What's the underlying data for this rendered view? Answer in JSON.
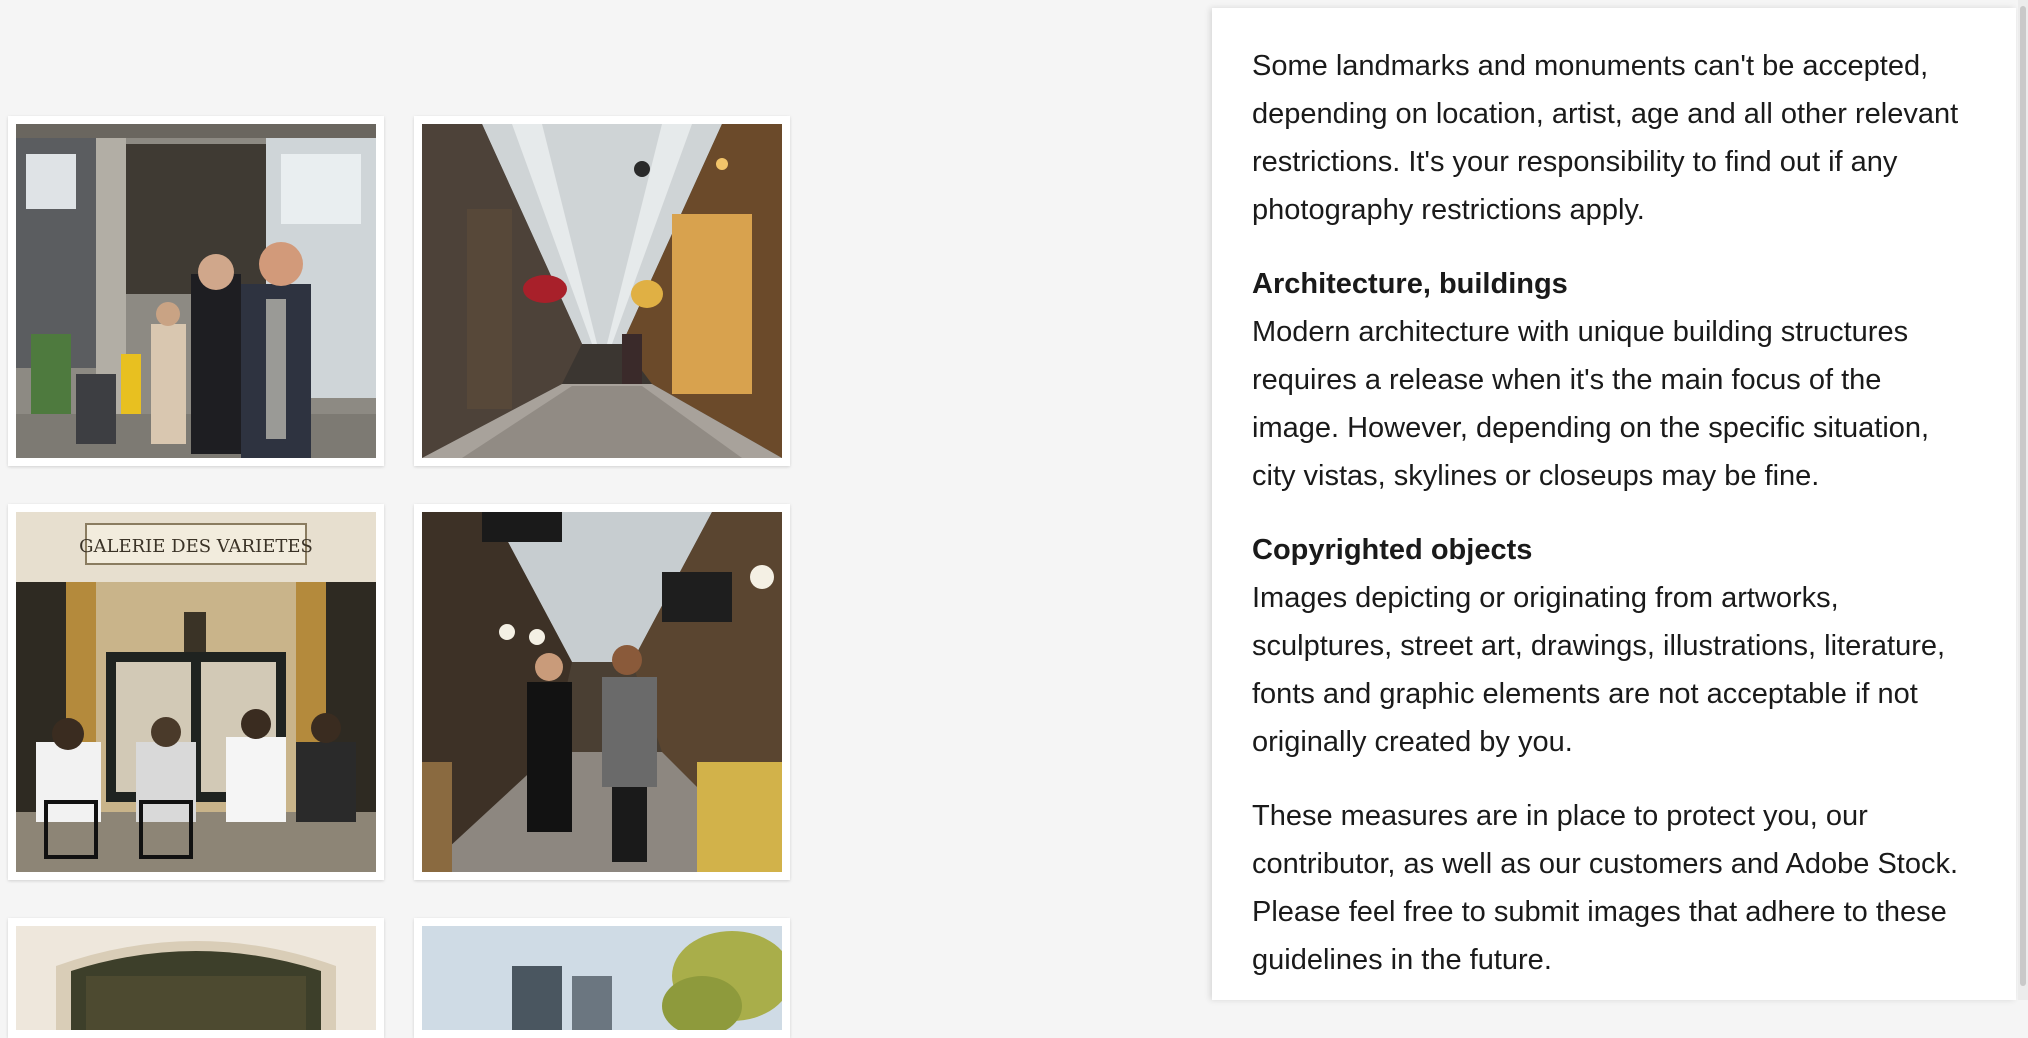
{
  "gallery": {
    "items": [
      {
        "name": "photo-passage-entrance-couple",
        "alt": "Couple at a Paris passage entrance"
      },
      {
        "name": "photo-covered-arcade-glass-roof",
        "alt": "Covered arcade with glass roof and shops"
      },
      {
        "name": "photo-galerie-des-varietes-cafe",
        "alt": "People seated at cafe under Galerie des Varietes sign",
        "sign_text": "GALERIE DES VARIETES"
      },
      {
        "name": "photo-arcade-two-men-walking",
        "alt": "Two men walking through a covered passage"
      },
      {
        "name": "photo-ornate-doorway",
        "alt": "Ornate green doorway"
      },
      {
        "name": "photo-street-sky-trees",
        "alt": "Street view with sky and trees"
      }
    ]
  },
  "guidelines": {
    "intro": "Some landmarks and monuments can't be accepted, depending on location, artist, age and all other relevant restrictions. It's your responsibility to find out if any photography restrictions apply.",
    "architecture_heading": "Architecture, buildings",
    "architecture_text": "Modern architecture with unique building structures requires a release when it's the main focus of the image. However, depending on the specific situation, city vistas, skylines or closeups may be fine.",
    "copyright_heading": "Copyrighted objects",
    "copyright_text": "Images depicting or originating from artworks, sculptures, street art, drawings, illustrations, literature, fonts and graphic elements are not acceptable if not originally created by you.",
    "closing": "These measures are in place to protect you, our contributor, as well as our customers and Adobe Stock. Please feel free to submit images that adhere to these guidelines in the future."
  },
  "colors": {
    "page_bg": "#f5f5f5",
    "panel_bg": "#ffffff",
    "text": "#1a1a1a"
  }
}
